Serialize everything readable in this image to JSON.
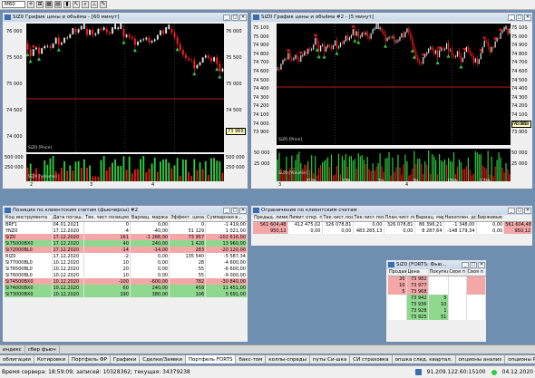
{
  "toolbar": {
    "interval": "M60",
    "icons": [
      "crosshair-icon",
      "plus-icon",
      "grid-icon",
      "table-icon",
      "chart-icon",
      "cursor-icon",
      "zoom-icon",
      "ruler-icon",
      "pen-icon"
    ]
  },
  "chart1": {
    "title": "SiZ0 График цены и объёма - [60 минут]",
    "price_ticks": [
      "76 000",
      "75 500",
      "75 000",
      "74 500",
      "74 000"
    ],
    "cur_price": "73 969",
    "cur_tag": "73 969",
    "series_label": "SiZ0 [Price]",
    "vol_ticks": [
      "500 000",
      "250 000"
    ],
    "vol_label": "SiZ0 [Volume]",
    "x_ticks": [
      "2",
      "3",
      "4"
    ]
  },
  "chart2": {
    "title": "SiZ0 График цены и объёма #2 - [5 минут]",
    "price_ticks": [
      "75 100",
      "75 000",
      "74 900",
      "74 800",
      "74 700",
      "74 600",
      "74 500",
      "74 400",
      "74 300",
      "74 200",
      "74 100",
      "74 000",
      "73 900"
    ],
    "cur_price": "73 969",
    "cur_tag": "73 969",
    "series_label": "SiZ0 [Price]",
    "vol_ticks": [
      "50 000",
      "25 000"
    ],
    "vol_label": "SiZ0 [Volume]",
    "x_ticks": [
      "21th",
      "23h",
      "1h",
      "3h",
      "15th",
      "17th"
    ],
    "bottom_ticks": [
      "3",
      "4"
    ]
  },
  "positions": {
    "title": "Позиции по клиентским счетам (фьючерсы) #2",
    "headers": [
      "Код инструмента",
      "Дата погаш.",
      "Тек. чист.позиция",
      "Вариац. маржа",
      "Эффект. цена",
      "Суммарная в..."
    ],
    "rows": [
      {
        "code": "BRF1",
        "date": "04.01.2021",
        "pos": "0",
        "vm": "0,00",
        "price": "0",
        "sum": "-1 419,00",
        "bg": "w"
      },
      {
        "code": "YNZ0",
        "date": "17.12.2020",
        "pos": "-4",
        "vm": "-40,00",
        "price": "51 129",
        "sum": "1 021,00",
        "bg": "w"
      },
      {
        "code": "SiZ0",
        "date": "17.12.2020",
        "pos": "161",
        "vm": "-1 288,00",
        "price": "73 957",
        "sum": "-102 616,00",
        "bg": "p"
      },
      {
        "code": "Si75000BX0",
        "date": "17.12.2020",
        "pos": "40",
        "vm": "240,00",
        "price": "1 420",
        "sum": "13 960,00",
        "bg": "g"
      },
      {
        "code": "Si72000BL0",
        "date": "17.12.2020",
        "pos": "-14",
        "vm": "-14,00",
        "price": "283",
        "sum": "-20 120,00",
        "bg": "p"
      },
      {
        "code": "RIZ0",
        "date": "17.12.2020",
        "pos": "-2",
        "vm": "0,00",
        "price": "135 540",
        "sum": "-5 587,34",
        "bg": "w"
      },
      {
        "code": "Si77000BL0",
        "date": "10.12.2020",
        "pos": "10",
        "vm": "0,00",
        "price": "28",
        "sum": "-4 600,00",
        "bg": "w"
      },
      {
        "code": "Si76500BL0",
        "date": "10.12.2020",
        "pos": "20",
        "vm": "0,00",
        "price": "55",
        "sum": "-6 600,00",
        "bg": "w"
      },
      {
        "code": "Si76000BL0",
        "date": "10.12.2020",
        "pos": "10",
        "vm": "0,00",
        "price": "55",
        "sum": "-9 000,00",
        "bg": "w"
      },
      {
        "code": "Si74500BX0",
        "date": "10.12.2020",
        "pos": "-100",
        "vm": "-600,00",
        "price": "782",
        "sum": "-30 840,00",
        "bg": "p"
      },
      {
        "code": "Si74000BX0",
        "date": "10.12.2020",
        "pos": "60",
        "vm": "240,00",
        "price": "458",
        "sum": "11 451,00",
        "bg": "g"
      },
      {
        "code": "Si73000BX0",
        "date": "10.12.2020",
        "pos": "190",
        "vm": "380,00",
        "price": "106",
        "sum": "5 691,00",
        "bg": "g"
      }
    ]
  },
  "limits": {
    "title": "Ограничения по клиентским счетам",
    "headers": [
      "Предыд. лимит откр. п",
      "Лимит откр. позиций",
      "Тек.чист.поз.",
      "Тек.чист.поз. (",
      "План.чист.поз.",
      "Вариац. маржа",
      "Накоплен. доход",
      "Биржевые"
    ],
    "rows": [
      {
        "c": [
          "561 604,48",
          "412 475,02",
          "326 078,81",
          "0,00",
          "326 078,81",
          "86 396,21",
          "-1 348,00",
          "0,00",
          "561 604,48"
        ],
        "bg": "p"
      },
      {
        "c": [
          "950,12",
          "0,00",
          "0,00",
          "483 265,13",
          "0,00",
          "8 287,64",
          "-148 179,34",
          "0,00",
          "950,12"
        ],
        "bg": "p"
      }
    ]
  },
  "glass": {
    "title": "SiZ0 [FORTS: Фью...",
    "headers": [
      "Продаж",
      "Цена",
      "Покупка",
      "Своя п",
      "Своя п"
    ],
    "rows": [
      {
        "sell": "20",
        "price": "73 982",
        "buy": ""
      },
      {
        "sell": "10",
        "price": "73 977",
        "buy": ""
      },
      {
        "sell": "5",
        "price": "73 968",
        "buy": ""
      },
      {
        "sell": "",
        "price": "73 942",
        "buy": "5"
      },
      {
        "sell": "",
        "price": "73 936",
        "buy": "10"
      },
      {
        "sell": "",
        "price": "73 928",
        "buy": "1"
      },
      {
        "sell": "",
        "price": "73 925",
        "buy": "51"
      }
    ]
  },
  "tabs_row1": [
    "индекс",
    "сбер фьюч"
  ],
  "tabs_row2": [
    "облигации",
    "Котировки",
    "Портфель ФР",
    "Графики",
    "Сделки/Заявки",
    "Портфель FORTS",
    "бакс-том",
    "коллы-спреды",
    "путы Си-шка",
    "СИ страховка",
    "опшка след. квартал.",
    "опционы анализ",
    "опционы РТС",
    "нефть"
  ],
  "status": {
    "server_time": "Время сервера: 18:59:09; записей: 10328362; текущая: 34379238",
    "ip": "91.209.122.60:15100",
    "date": "04.12.2020"
  },
  "colors": {
    "candle_up": "#e8e8e8",
    "candle_down": "#ff2020",
    "signal_buy": "#2ecc40",
    "signal_sell": "#e81818",
    "level": "#ff2020"
  }
}
